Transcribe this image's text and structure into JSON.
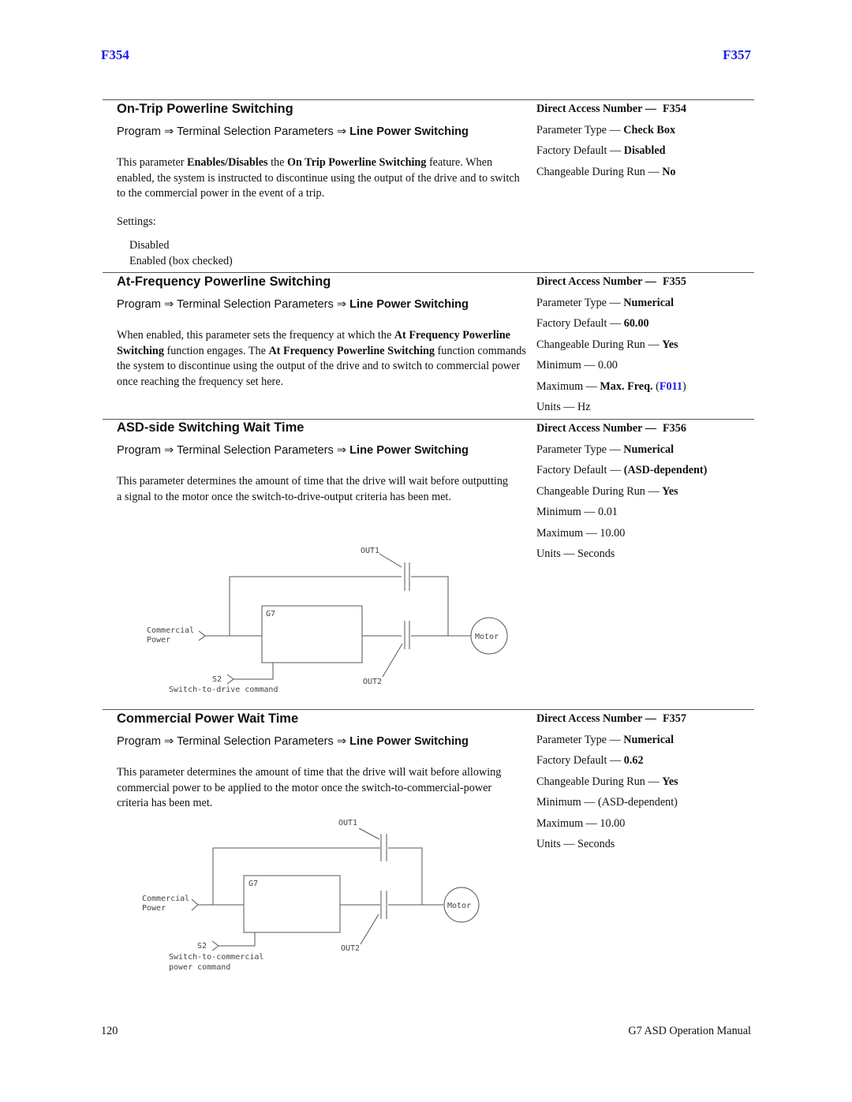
{
  "header": {
    "left_code": "F354",
    "right_code": "F357"
  },
  "breadcrumb": {
    "part1": "Program",
    "part2": "Terminal Selection Parameters",
    "part3": "Line Power Switching",
    "arrow": "⇒"
  },
  "labels": {
    "direct_access": "Direct Access Number —",
    "parameter_type": "Parameter Type — ",
    "factory_default": "Factory Default — ",
    "changeable": "Changeable During Run — ",
    "minimum": "Minimum — ",
    "maximum": "Maximum — ",
    "units": "Units — "
  },
  "sections": [
    {
      "title": "On-Trip Powerline Switching",
      "desc": [
        {
          "t": "This parameter "
        },
        {
          "b": "Enables/Disables"
        },
        {
          "t": " the "
        },
        {
          "b": "On Trip Powerline Switching"
        },
        {
          "t": " feature. When enabled, the system is instructed to discontinue using the output of the drive and to switch to the commercial power in the event of a trip."
        }
      ],
      "settings_label": "Settings:",
      "settings": [
        "Disabled",
        "Enabled (box checked)"
      ],
      "props": {
        "number": "F354",
        "type": "Check Box",
        "default": "Disabled",
        "changeable": "No"
      }
    },
    {
      "title": "At-Frequency Powerline Switching",
      "desc": [
        {
          "t": "When enabled, this parameter sets the frequency at which the "
        },
        {
          "b": "At Frequency Powerline Switching"
        },
        {
          "t": " function engages. The "
        },
        {
          "b": "At Frequency Powerline Switching"
        },
        {
          "t": " function commands the system to discontinue using the output of the drive and to switch to commercial power once reaching the frequency set here."
        }
      ],
      "props": {
        "number": "F355",
        "type": "Numerical",
        "default": "60.00",
        "changeable": "Yes",
        "minimum": "0.00",
        "maximum_text": "Max. Freq.",
        "maximum_link": "F011",
        "units": "Hz"
      }
    },
    {
      "title": "ASD-side Switching Wait Time",
      "desc": [
        {
          "t": "This parameter determines the amount of time that the drive will wait before outputting a signal to the motor once the switch-to-drive-output criteria has been met."
        }
      ],
      "props": {
        "number": "F356",
        "type": "Numerical",
        "default": "(ASD-dependent)",
        "changeable": "Yes",
        "minimum": "0.01",
        "maximum": "10.00",
        "units": "Seconds"
      },
      "diagram": {
        "out1": "OUT1",
        "out2": "OUT2",
        "g7": "G7",
        "commercial1": "Commercial",
        "commercial2": "Power",
        "motor": "Motor",
        "s2": "S2",
        "command1": "Switch-to-drive command",
        "command2": ""
      }
    },
    {
      "title": "Commercial Power Wait Time",
      "desc": [
        {
          "t": "This parameter determines the amount of time that the drive will wait before allowing commercial power to be applied to the motor once the switch-to-commercial-power criteria has been met."
        }
      ],
      "props": {
        "number": "F357",
        "type": "Numerical",
        "default": "0.62",
        "changeable": "Yes",
        "minimum": "(ASD-dependent)",
        "maximum": "10.00",
        "units": "Seconds"
      },
      "diagram": {
        "out1": "OUT1",
        "out2": "OUT2",
        "g7": "G7",
        "commercial1": "Commercial",
        "commercial2": "Power",
        "motor": "Motor",
        "s2": "S2",
        "command1": "Switch-to-commercial",
        "command2": "power command"
      }
    }
  ],
  "footer": {
    "page_number": "120",
    "manual_title": "G7 ASD Operation Manual"
  }
}
